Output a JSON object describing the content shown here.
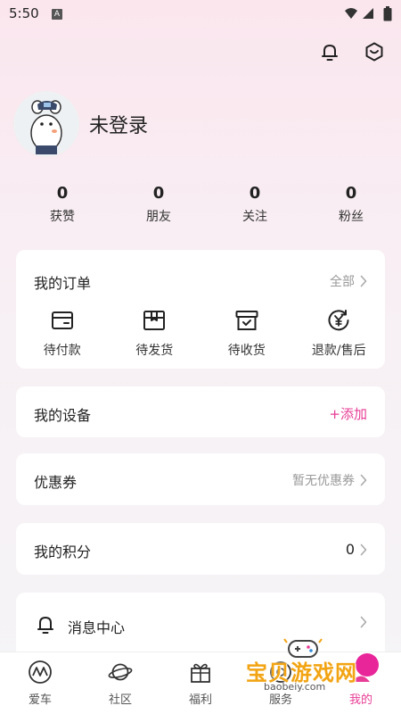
{
  "status_bar": {
    "time": "5:50",
    "badge": "A"
  },
  "header": {
    "icons": [
      "bell-icon",
      "settings-hex-icon"
    ]
  },
  "profile": {
    "name": "未登录"
  },
  "stats": [
    {
      "value": "0",
      "label": "获赞"
    },
    {
      "value": "0",
      "label": "朋友"
    },
    {
      "value": "0",
      "label": "关注"
    },
    {
      "value": "0",
      "label": "粉丝"
    }
  ],
  "orders": {
    "title": "我的订单",
    "all_label": "全部",
    "items": [
      {
        "label": "待付款",
        "icon": "wallet-icon"
      },
      {
        "label": "待发货",
        "icon": "package-icon"
      },
      {
        "label": "待收货",
        "icon": "inbox-check-icon"
      },
      {
        "label": "退款/售后",
        "icon": "refund-yen-icon"
      }
    ]
  },
  "device": {
    "title": "我的设备",
    "action": "+添加"
  },
  "coupon": {
    "title": "优惠券",
    "status": "暂无优惠券"
  },
  "points": {
    "title": "我的积分",
    "value": "0"
  },
  "messages": {
    "title": "消息中心"
  },
  "tabbar": {
    "items": [
      {
        "label": "爱车",
        "icon": "car-logo-icon"
      },
      {
        "label": "社区",
        "icon": "planet-icon"
      },
      {
        "label": "福利",
        "icon": "gift-icon"
      },
      {
        "label": "服务",
        "icon": "service-icon"
      },
      {
        "label": "我的",
        "icon": "profile-icon"
      }
    ],
    "active_index": 4
  },
  "watermark": {
    "text": "宝贝游戏网",
    "url": "baobeiy.com"
  },
  "colors": {
    "accent": "#e83c96",
    "muted": "#999999",
    "card": "#ffffff"
  }
}
